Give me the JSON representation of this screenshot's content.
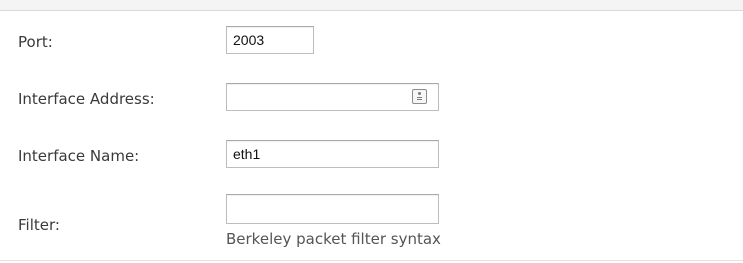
{
  "form": {
    "port": {
      "label": "Port:",
      "value": "2003"
    },
    "interface_address": {
      "label": "Interface Address:",
      "value": "",
      "icon": "autofill-contact-icon"
    },
    "interface_name": {
      "label": "Interface Name:",
      "value": "eth1"
    },
    "filter": {
      "label": "Filter:",
      "value": "",
      "help": "Berkeley packet filter syntax"
    }
  },
  "colors": {
    "label_text": "#3a3a3a",
    "help_text": "#555555",
    "input_border": "#bdbdbd",
    "background": "#ffffff"
  }
}
